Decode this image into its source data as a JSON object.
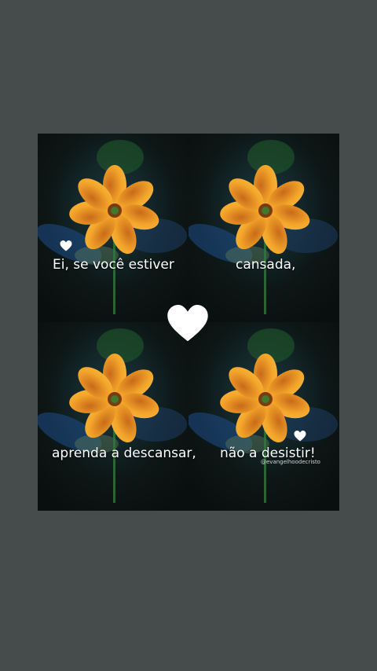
{
  "captions": {
    "top_left": "Ei, se você estiver",
    "top_right": "cansada,",
    "bottom_left": "aprenda a descansar,",
    "bottom_right": "não a desistir!"
  },
  "watermark": "@evangelhoodecristo",
  "colors": {
    "background": "#464b4b",
    "card": "#0c100f",
    "petal": "#f3a52a",
    "petal_dark": "#c8641a",
    "stem": "#2f7a3a",
    "leaf_blue": "#1e4f8a",
    "heart": "#ffffff"
  },
  "icons": {
    "heart": "heart-icon"
  }
}
